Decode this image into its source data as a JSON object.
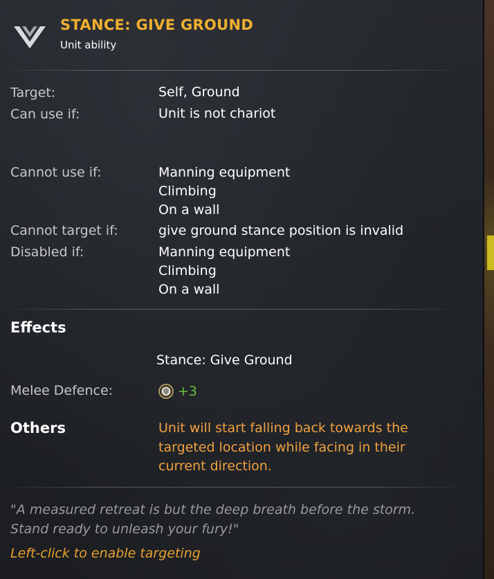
{
  "header": {
    "title": "STANCE: GIVE GROUND",
    "subtitle": "Unit ability",
    "icon": "give-ground-chevron-icon"
  },
  "conditions": {
    "target_label": "Target:",
    "target_value": "Self, Ground",
    "can_use_label": "Can use if:",
    "can_use_value": "Unit is not chariot",
    "cannot_use_label": "Cannot use if:",
    "cannot_use_values": [
      "Manning equipment",
      "Climbing",
      "On a wall"
    ],
    "cannot_target_label": "Cannot target if:",
    "cannot_target_value": "give ground stance position is invalid",
    "disabled_label": "Disabled if:",
    "disabled_values": [
      "Manning equipment",
      "Climbing",
      "On a wall"
    ]
  },
  "effects": {
    "heading": "Effects",
    "stance_name": "Stance: Give Ground",
    "stat_label": "Melee Defence:",
    "stat_value": "+3",
    "stat_icon": "melee-defence-shield-icon"
  },
  "others": {
    "heading": "Others",
    "text": "Unit will start falling back towards the targeted location while facing in their current direction."
  },
  "flavor_text": "\"A measured retreat is but the deep breath before the storm. Stand ready to unleash your fury!\"",
  "hint": "Left-click to enable targeting",
  "colors": {
    "title": "#f0b030",
    "positive_stat": "#6ac040",
    "others_text": "#f0a040",
    "hint": "#e8a030",
    "label": "#c8c8c8",
    "flavor": "#9a9a9a"
  }
}
